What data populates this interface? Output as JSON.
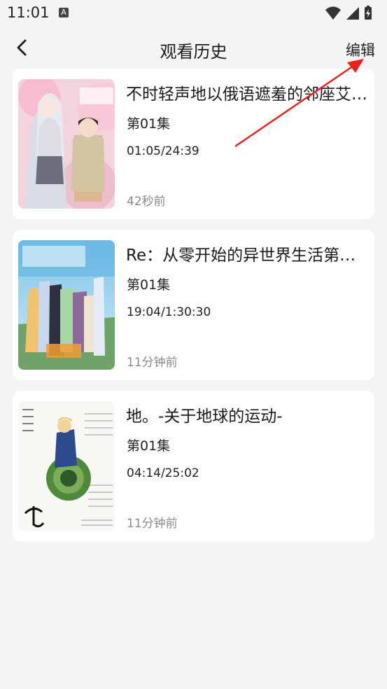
{
  "status_bar": {
    "time": "11:01",
    "notification_glyph": "A"
  },
  "header": {
    "title": "观看历史",
    "edit_label": "编辑"
  },
  "history": [
    {
      "title": "不时轻声地以俄语遮羞的邻座艾莉同学",
      "episode": "第01集",
      "progress": "01:05/24:39",
      "watched_ago": "42秒前"
    },
    {
      "title": "Re：从零开始的异世界生活第三季",
      "episode": "第01集",
      "progress": "19:04/1:30:30",
      "watched_ago": "11分钟前"
    },
    {
      "title": "地。-关于地球的运动-",
      "episode": "第01集",
      "progress": "04:14/25:02",
      "watched_ago": "11分钟前"
    }
  ],
  "colors": {
    "background": "#f4f4f4",
    "card": "#ffffff",
    "annotation_arrow": "#e8231c",
    "muted_text": "#8a8a8a"
  },
  "icons": {
    "back": "chevron-left-icon",
    "wifi": "wifi-icon",
    "signal": "signal-icon",
    "battery": "battery-charging-icon"
  }
}
